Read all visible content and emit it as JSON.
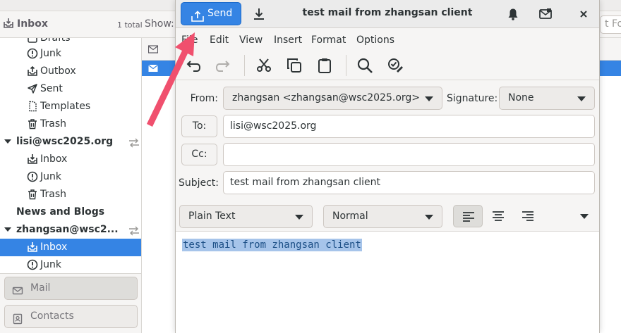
{
  "background_window": {
    "folder_title": "Inbox",
    "folder_total": "1 total",
    "show_label": "Show:",
    "search_scope_partial": "t Folo",
    "tree": [
      {
        "label": "Drafts",
        "icon": "drafts-icon",
        "type": "folder"
      },
      {
        "label": "Junk",
        "icon": "junk-icon",
        "type": "folder"
      },
      {
        "label": "Outbox",
        "icon": "outbox-icon",
        "type": "folder"
      },
      {
        "label": "Sent",
        "icon": "sent-icon",
        "type": "folder"
      },
      {
        "label": "Templates",
        "icon": "templates-icon",
        "type": "folder"
      },
      {
        "label": "Trash",
        "icon": "trash-icon",
        "type": "folder"
      },
      {
        "label": "lisi@wsc2025.org",
        "icon": "",
        "type": "account"
      },
      {
        "label": "Inbox",
        "icon": "inbox-icon",
        "type": "folder"
      },
      {
        "label": "Junk",
        "icon": "junk-icon",
        "type": "folder"
      },
      {
        "label": "Trash",
        "icon": "trash-icon",
        "type": "folder"
      },
      {
        "label": "News and Blogs",
        "icon": "",
        "type": "account"
      },
      {
        "label": "zhangsan@wsc2...",
        "icon": "",
        "type": "account"
      },
      {
        "label": "Inbox",
        "icon": "inbox-icon",
        "type": "folder",
        "selected": true
      },
      {
        "label": "Junk",
        "icon": "junk-icon",
        "type": "folder"
      }
    ],
    "switcher": {
      "mail": "Mail",
      "contacts": "Contacts"
    }
  },
  "composer": {
    "title": "test mail from zhangsan client",
    "send_label": "Send",
    "menu": [
      "File",
      "Edit",
      "View",
      "Insert",
      "Format",
      "Options"
    ],
    "from_label": "From:",
    "from_value": "zhangsan <zhangsan@wsc2025.org>",
    "signature_label": "Signature:",
    "signature_value": "None",
    "to_label": "To:",
    "to_value": "lisi@wsc2025.org",
    "cc_label": "Cc:",
    "cc_value": "",
    "subject_label": "Subject:",
    "subject_value": "test mail from zhangsan client",
    "format_mode": "Plain Text",
    "paragraph_style": "Normal",
    "body_text": "test mail from zhangsan client"
  },
  "colors": {
    "accent": "#3584e4",
    "annotation_arrow": "#f0506e",
    "selection": "#a6c4ea"
  }
}
